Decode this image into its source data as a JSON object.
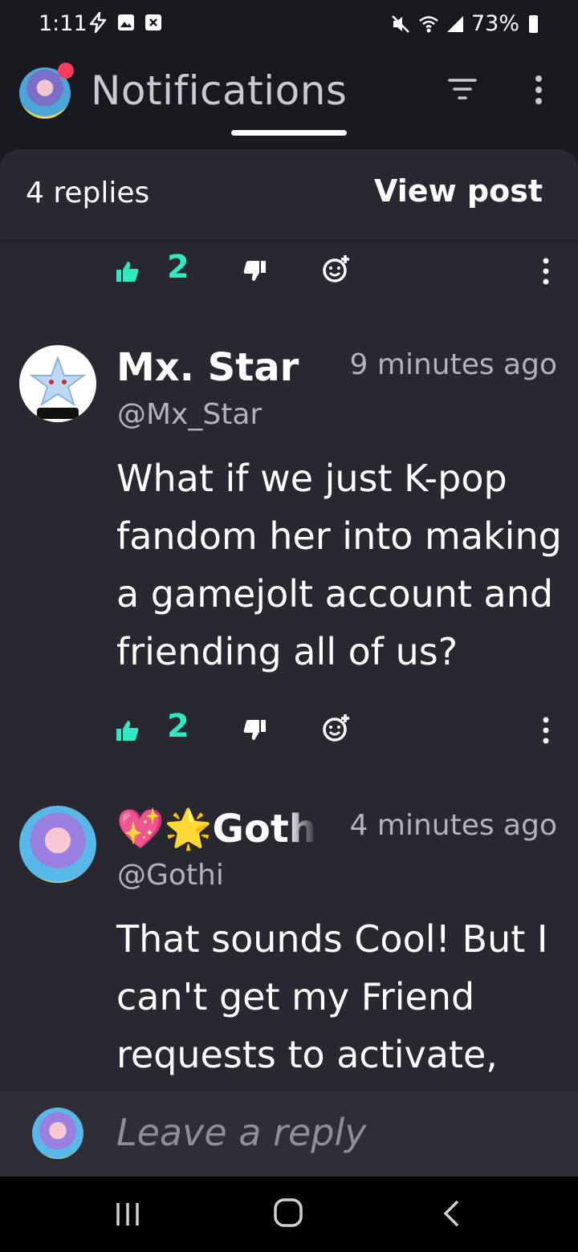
{
  "status_bar": {
    "time": "1:11",
    "battery": "73%",
    "icons": [
      "flash-icon",
      "gallery-icon",
      "close-box-icon",
      "mute-icon",
      "wifi-icon",
      "signal-icon",
      "battery-icon"
    ]
  },
  "header": {
    "title": "Notifications",
    "notification_dot_color": "#ff3b5c"
  },
  "thread": {
    "replies_label": "4 replies",
    "view_post_label": "View post"
  },
  "top_actions": {
    "like_count": "2"
  },
  "comments": [
    {
      "name": "Mx. Star",
      "time": "9 minutes ago",
      "handle": "@Mx_Star",
      "body": "What if we just K-pop fandom her into making a gamejolt account and friending all of us?",
      "like_count": "2"
    },
    {
      "name": "💖🌟Gothi",
      "time": "4 minutes ago",
      "handle": "@Gothi",
      "body": "That sounds Cool! But I can't get my Friend requests to activate,"
    }
  ],
  "composer": {
    "placeholder": "Leave a reply"
  },
  "colors": {
    "accent": "#2fe9c0",
    "background": "#191920",
    "sheet": "#29272f"
  }
}
